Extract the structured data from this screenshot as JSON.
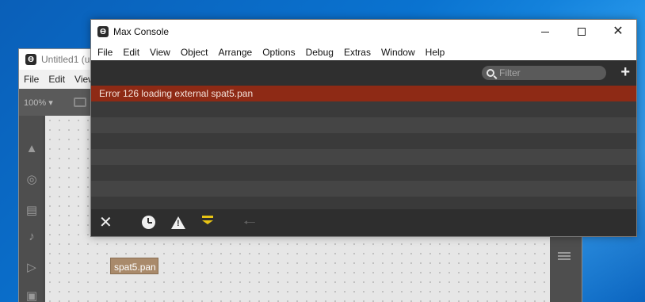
{
  "back_window": {
    "title": "Untitled1 (u",
    "menu": [
      "File",
      "Edit",
      "View"
    ],
    "zoom": "100% ▾",
    "object_box_text": "spat5.pan"
  },
  "console": {
    "title": "Max Console",
    "menu": [
      "File",
      "Edit",
      "View",
      "Object",
      "Arrange",
      "Options",
      "Debug",
      "Extras",
      "Window",
      "Help"
    ],
    "filter_placeholder": "Filter",
    "messages": [
      {
        "text": "Error 126 loading external spat5.pan",
        "level": "error"
      }
    ],
    "colors": {
      "error_row": "#8e2a15",
      "autoscroll_icon": "#e8c414"
    }
  }
}
